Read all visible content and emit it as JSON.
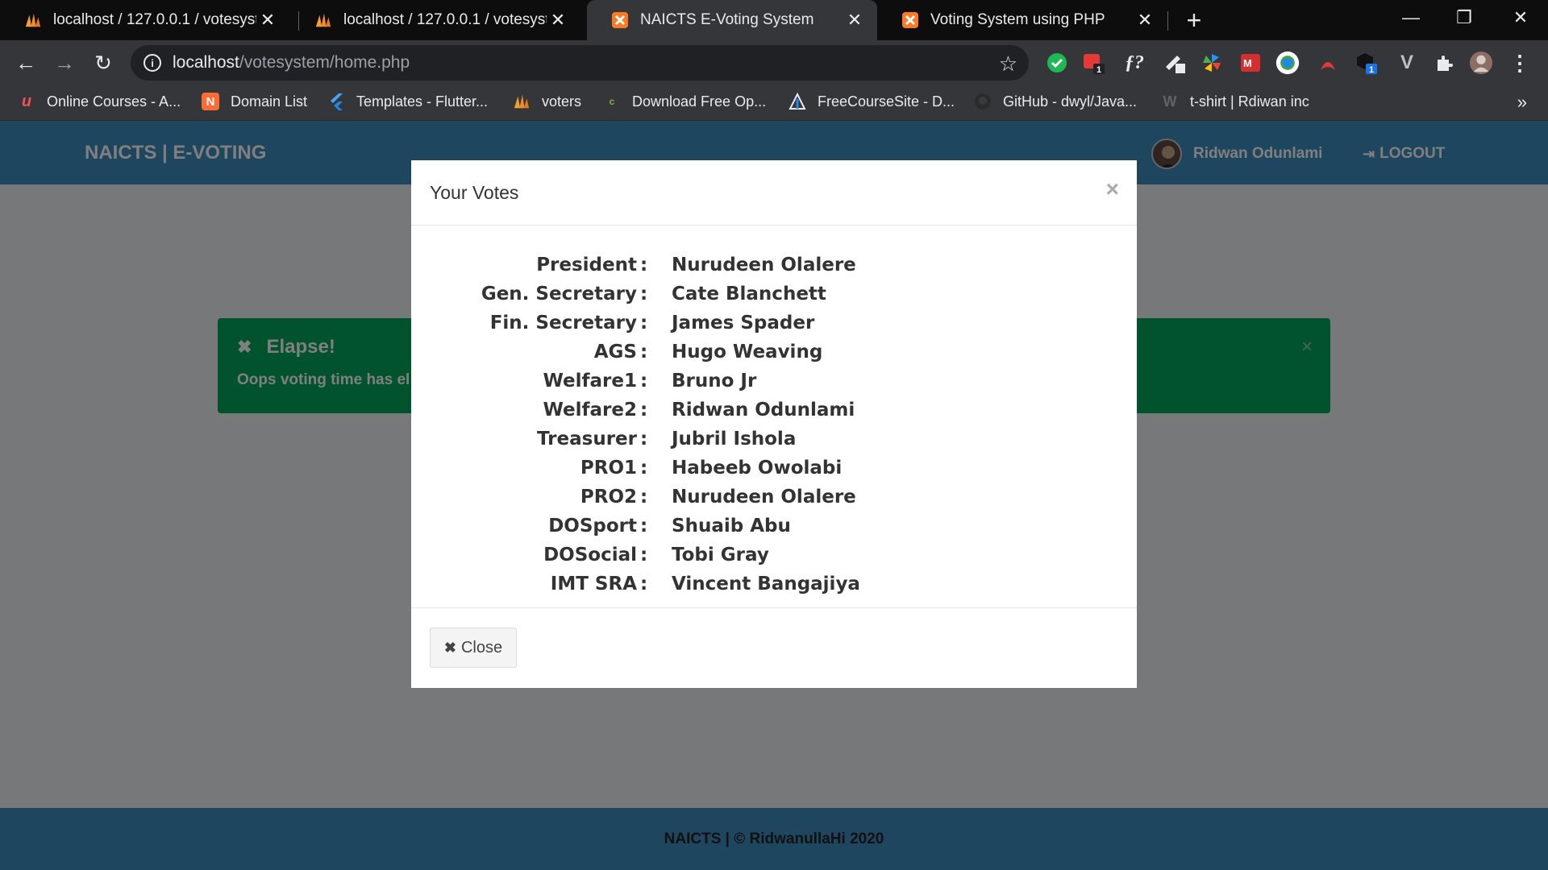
{
  "browser": {
    "tabs": [
      {
        "title": "localhost / 127.0.0.1 / votesystem",
        "icon": "phpmyadmin-icon"
      },
      {
        "title": "localhost / 127.0.0.1 / votesystem",
        "icon": "phpmyadmin-icon"
      },
      {
        "title": "NAICTS E-Voting System",
        "icon": "xampp-icon"
      },
      {
        "title": "Voting System using PHP",
        "icon": "xampp-icon"
      }
    ],
    "url_host": "localhost",
    "url_path": "/votesystem/home.php",
    "bookmarks": [
      {
        "label": "Online Courses - A...",
        "icon": "udemy-icon"
      },
      {
        "label": "Domain List",
        "icon": "domain-icon"
      },
      {
        "label": "Templates - Flutter...",
        "icon": "flutter-icon"
      },
      {
        "label": "voters",
        "icon": "phpmyadmin-icon"
      },
      {
        "label": "Download Free Op...",
        "icon": "download-icon"
      },
      {
        "label": "FreeCourseSite - D...",
        "icon": "freecoursesite-icon"
      },
      {
        "label": "GitHub - dwyl/Java...",
        "icon": "github-icon"
      },
      {
        "label": "t-shirt | Rdiwan inc",
        "icon": "wordpress-icon"
      }
    ],
    "extension_badges": [
      "1",
      "1"
    ],
    "colors": {
      "tabstrip": "#0d0d0d",
      "toolbar": "#35363a",
      "omnibox": "#202124"
    }
  },
  "app": {
    "brand": "NAICTS | E-VOTING",
    "user_name": "Ridwan Odunlami",
    "logout_label": "LOGOUT",
    "alert": {
      "title": "Elapse!",
      "message": "Oops voting time has el",
      "close": "×"
    },
    "footer": "NAICTS | © RidwanullaHi 2020",
    "colors": {
      "navbar": "#3c8dbc",
      "alert": "#00a65a",
      "page": "#ecf0f5"
    }
  },
  "modal": {
    "title": "Your Votes",
    "close_x": "×",
    "close_button": "Close",
    "votes": [
      {
        "position": "President",
        "candidate": "Nurudeen Olalere"
      },
      {
        "position": "Gen. Secretary",
        "candidate": "Cate Blanchett"
      },
      {
        "position": "Fin. Secretary",
        "candidate": "James Spader"
      },
      {
        "position": "AGS",
        "candidate": "Hugo Weaving"
      },
      {
        "position": "Welfare1",
        "candidate": "Bruno Jr"
      },
      {
        "position": "Welfare2",
        "candidate": "Ridwan Odunlami"
      },
      {
        "position": "Treasurer",
        "candidate": "Jubril Ishola"
      },
      {
        "position": "PRO1",
        "candidate": "Habeeb Owolabi"
      },
      {
        "position": "PRO2",
        "candidate": "Nurudeen Olalere"
      },
      {
        "position": "DOSport",
        "candidate": "Shuaib Abu"
      },
      {
        "position": "DOSocial",
        "candidate": "Tobi Gray"
      },
      {
        "position": "IMT SRA",
        "candidate": "Vincent Bangajiya"
      }
    ]
  }
}
